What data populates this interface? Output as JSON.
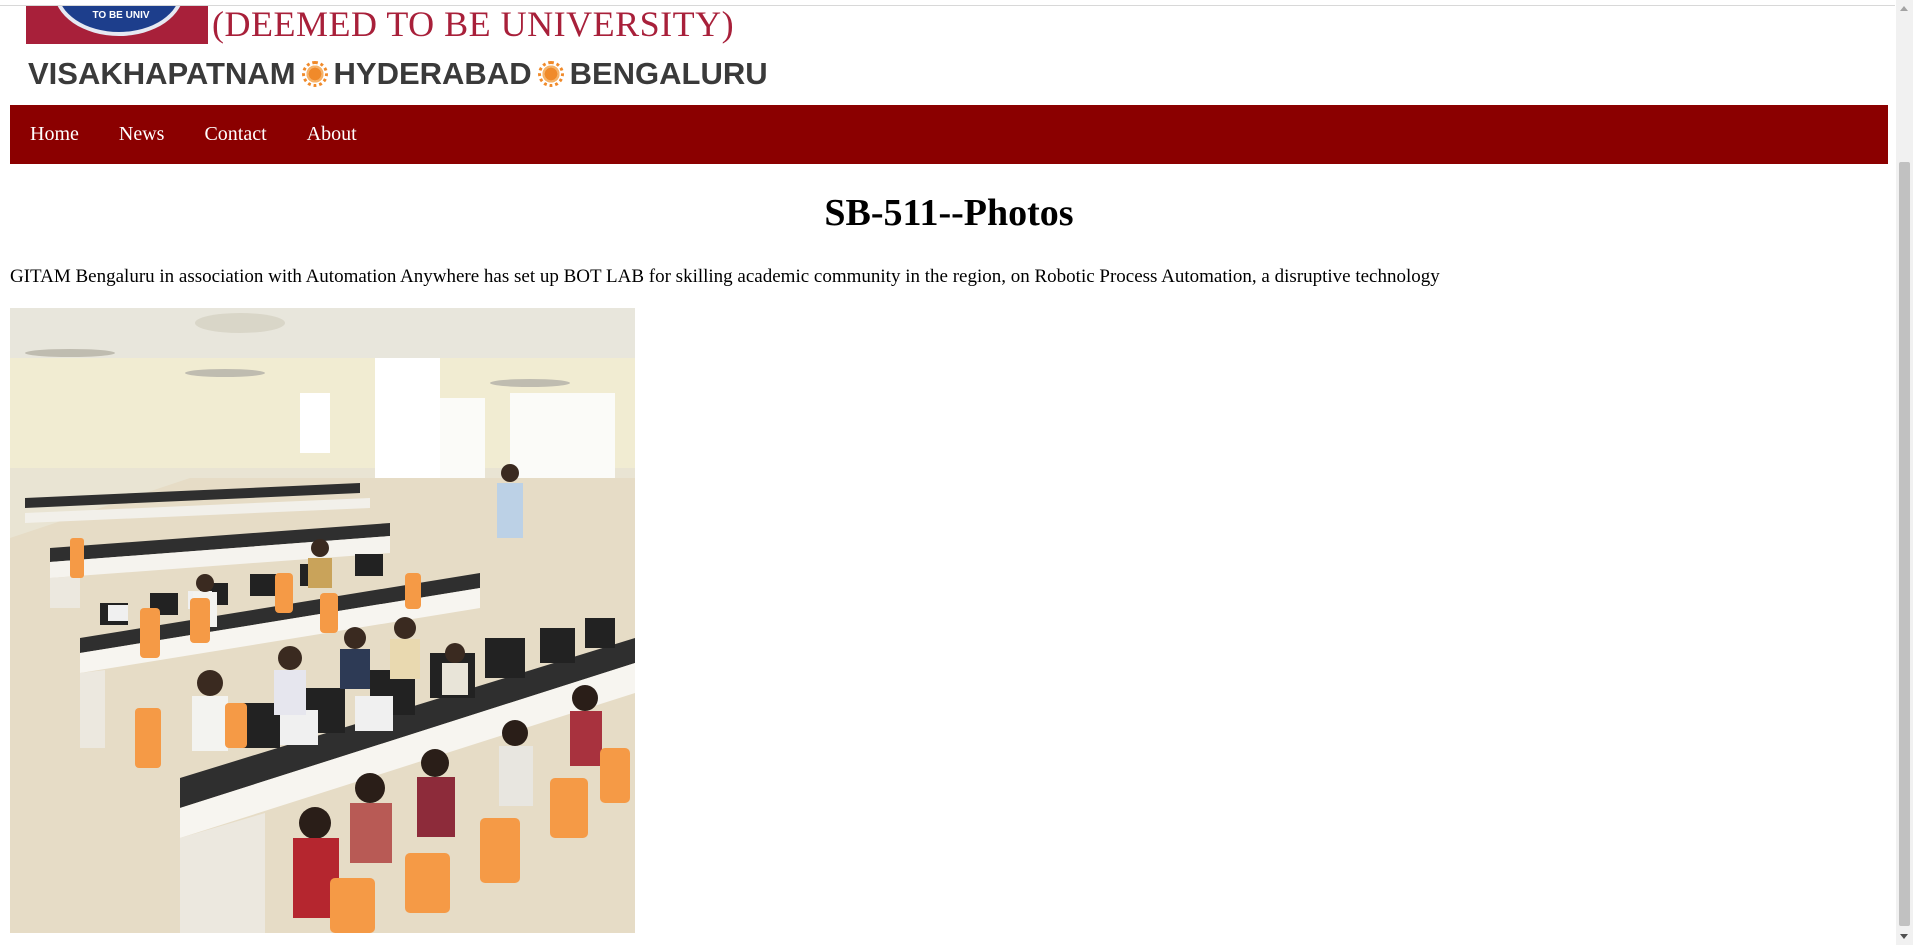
{
  "logo": {
    "emblem_text": "TO BE UNIV",
    "deemed_text": "(DEEMED TO BE UNIVERSITY)",
    "cities": [
      "VISAKHAPATNAM",
      "HYDERABAD",
      "BENGALURU"
    ],
    "accent_color": "#a8203a"
  },
  "nav": {
    "background_color": "#8b0000",
    "items": [
      {
        "label": "Home"
      },
      {
        "label": "News"
      },
      {
        "label": "Contact"
      },
      {
        "label": "About"
      }
    ]
  },
  "main": {
    "title": "SB-511--Photos",
    "description": "GITAM Bengaluru in association with Automation Anywhere has set up BOT LAB for skilling academic community in the region, on Robotic Process Automation, a disruptive technology",
    "photo_subject": "computer lab with students seated at workstations with orange chairs"
  }
}
